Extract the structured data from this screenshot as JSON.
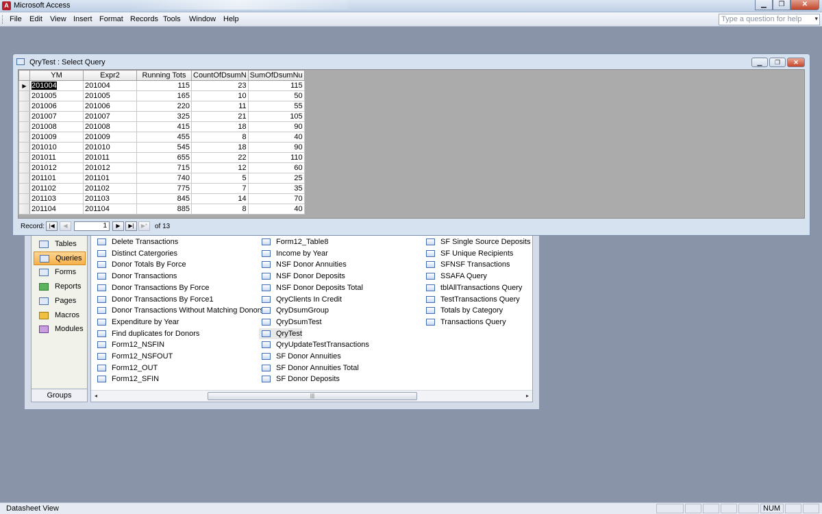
{
  "window": {
    "title": "Microsoft Access"
  },
  "menu": [
    "File",
    "Edit",
    "View",
    "Insert",
    "Format",
    "Records",
    "Tools",
    "Window",
    "Help"
  ],
  "help_placeholder": "Type a question for help",
  "groups": {
    "items": [
      "Tables",
      "Queries",
      "Forms",
      "Reports",
      "Pages",
      "Macros",
      "Modules"
    ],
    "selected": "Queries",
    "footer": "Groups"
  },
  "objects": {
    "col1": [
      "Delete Transactions",
      "Distinct Catergories",
      "Donor Totals By Force",
      "Donor Transactions",
      "Donor Transactions By Force",
      "Donor Transactions By Force1",
      "Donor Transactions Without Matching Donors",
      "Expenditure by Year",
      "Find duplicates for Donors",
      "Form12_NSFIN",
      "Form12_NSFOUT",
      "Form12_OUT",
      "Form12_SFIN"
    ],
    "col2": [
      "Form12_Table8",
      "Income by Year",
      "NSF Donor Annuities",
      "NSF Donor Deposits",
      "NSF Donor Deposits Total",
      "QryClients In Credit",
      "QryDsumGroup",
      "QryDsumTest",
      "QryTest",
      "QryUpdateTestTransactions",
      "SF Donor Annuities",
      "SF Donor Annuities Total",
      "SF Donor Deposits"
    ],
    "col3": [
      "SF Single Source Deposits",
      "SF Unique Recipients",
      "SFNSF Transactions",
      "SSAFA Query",
      "tblAllTransactions Query",
      "TestTransactions Query",
      "Totals by Category",
      "Transactions Query"
    ]
  },
  "query_window": {
    "title": "QryTest : Select Query",
    "columns": [
      "YM",
      "Expr2",
      "Running Tots",
      "CountOfDsumN",
      "SumOfDsumNu"
    ],
    "rows": [
      [
        "201004",
        "201004",
        "115",
        "23",
        "115"
      ],
      [
        "201005",
        "201005",
        "165",
        "10",
        "50"
      ],
      [
        "201006",
        "201006",
        "220",
        "11",
        "55"
      ],
      [
        "201007",
        "201007",
        "325",
        "21",
        "105"
      ],
      [
        "201008",
        "201008",
        "415",
        "18",
        "90"
      ],
      [
        "201009",
        "201009",
        "455",
        "8",
        "40"
      ],
      [
        "201010",
        "201010",
        "545",
        "18",
        "90"
      ],
      [
        "201011",
        "201011",
        "655",
        "22",
        "110"
      ],
      [
        "201012",
        "201012",
        "715",
        "12",
        "60"
      ],
      [
        "201101",
        "201101",
        "740",
        "5",
        "25"
      ],
      [
        "201102",
        "201102",
        "775",
        "7",
        "35"
      ],
      [
        "201103",
        "201103",
        "845",
        "14",
        "70"
      ],
      [
        "201104",
        "201104",
        "885",
        "8",
        "40"
      ]
    ],
    "record_label": "Record:",
    "record_current": "1",
    "record_of": "of  13"
  },
  "status": {
    "text": "Datasheet View",
    "num": "NUM"
  }
}
